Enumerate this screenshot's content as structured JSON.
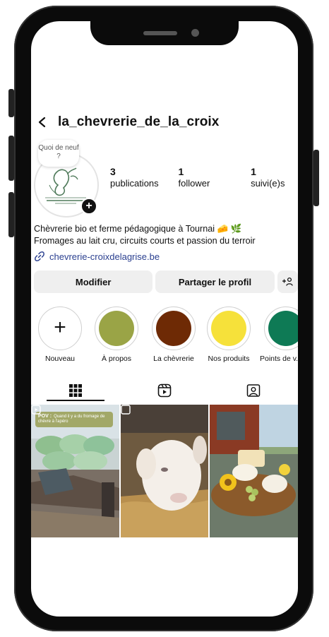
{
  "profile": {
    "username": "la_chevrerie_de_la_croix",
    "note": "Quoi de neuf ?",
    "stats": [
      {
        "value": "3",
        "label": "publications"
      },
      {
        "value": "1",
        "label": "follower"
      },
      {
        "value": "1",
        "label": "suivi(e)s"
      }
    ],
    "bio_line1": "Chèvrerie bio et ferme pédagogique à Tournai 🧀 🌿",
    "bio_line2": "Fromages au lait cru, circuits courts et passion du terroir",
    "link": "chevrerie-croixdelagrise.be"
  },
  "actions": {
    "edit": "Modifier",
    "share": "Partager le profil",
    "add_people": "+♀"
  },
  "highlights": [
    {
      "label": "Nouveau",
      "color": "#ffffff"
    },
    {
      "label": "À propos",
      "color": "#9aa446"
    },
    {
      "label": "La chèvrerie",
      "color": "#6e2a05"
    },
    {
      "label": "Nos produits",
      "color": "#f6e13a"
    },
    {
      "label": "Points de v...",
      "color": "#0e7a55"
    }
  ],
  "tabs": [
    "grid-icon",
    "reels-icon",
    "tagged-icon"
  ],
  "posts": [
    {
      "banner_tag": "POV :",
      "banner_text": "Quand il y a du fromage de chèvre à l'apéro"
    },
    {},
    {}
  ],
  "colors": {
    "link": "#2a3f8f",
    "button_bg": "#efefef"
  }
}
